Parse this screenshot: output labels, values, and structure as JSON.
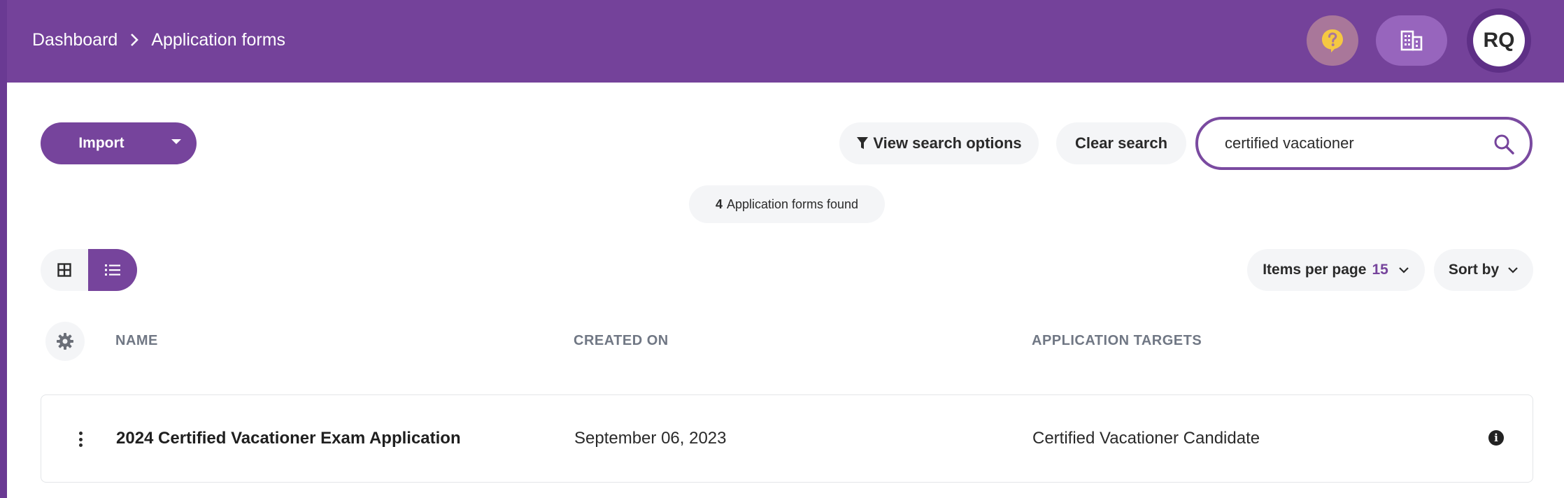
{
  "header": {
    "breadcrumb": [
      "Dashboard",
      "Application forms"
    ],
    "help_icon": "help-circle-icon",
    "org_icon": "building-icon",
    "avatar_initials": "RQ",
    "colors": {
      "bar": "#74429a",
      "help_bg": "#a9779a",
      "help_icon": "#f5c842"
    }
  },
  "toolbar": {
    "import_label": "Import",
    "view_search_options_label": "View search options",
    "clear_search_label": "Clear search",
    "search_value": "certified vacationer"
  },
  "results": {
    "count": "4",
    "label": "Application forms found"
  },
  "controls": {
    "items_per_page_label": "Items per page",
    "items_per_page_value": "15",
    "sort_by_label": "Sort by",
    "active_view": "list"
  },
  "table": {
    "columns": [
      "NAME",
      "CREATED ON",
      "APPLICATION TARGETS"
    ],
    "rows": [
      {
        "name": "2024 Certified Vacationer Exam Application",
        "created_on": "September 06, 2023",
        "targets": "Certified Vacationer Candidate",
        "info_glyph": "i"
      }
    ]
  }
}
